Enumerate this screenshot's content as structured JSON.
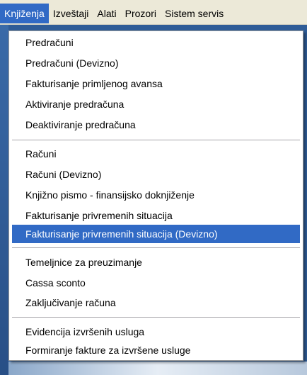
{
  "menubar": {
    "items": [
      {
        "label": "Knjiženja"
      },
      {
        "label": "Izveštaji"
      },
      {
        "label": "Alati"
      },
      {
        "label": "Prozori"
      },
      {
        "label": "Sistem servis"
      }
    ]
  },
  "menu": {
    "groups": [
      {
        "items": [
          {
            "label": "Predračuni"
          },
          {
            "label": "Predračuni (Devizno)"
          },
          {
            "label": "Fakturisanje primljenog avansa"
          },
          {
            "label": "Aktiviranje predračuna"
          },
          {
            "label": "Deaktiviranje predračuna"
          }
        ]
      },
      {
        "items": [
          {
            "label": "Računi"
          },
          {
            "label": "Računi (Devizno)"
          },
          {
            "label": "Knjižno pismo - finansijsko doknjiženje"
          },
          {
            "label": "Fakturisanje privremenih situacija"
          },
          {
            "label": "Fakturisanje privremenih situacija (Devizno)"
          }
        ]
      },
      {
        "items": [
          {
            "label": "Temeljnice za preuzimanje"
          },
          {
            "label": "Cassa sconto"
          },
          {
            "label": "Zaključivanje računa"
          }
        ]
      },
      {
        "items": [
          {
            "label": "Evidencija izvršenih usluga"
          },
          {
            "label": "Formiranje fakture za izvršene usluge"
          }
        ]
      }
    ]
  },
  "colors": {
    "highlight": "#316ac5",
    "menubar_bg": "#ece9d8",
    "desktop_bg": "#2f5c97"
  }
}
